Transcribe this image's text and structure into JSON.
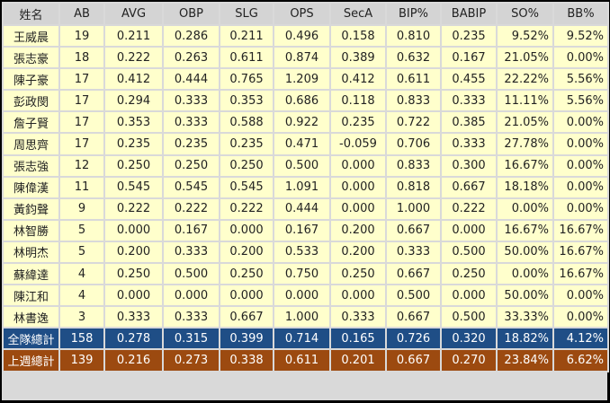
{
  "headers": [
    "姓名",
    "AB",
    "AVG",
    "OBP",
    "SLG",
    "OPS",
    "SecA",
    "BIP%",
    "BABIP",
    "SO%",
    "BB%"
  ],
  "rows": [
    [
      "王威晨",
      "19",
      "0.211",
      "0.286",
      "0.211",
      "0.496",
      "0.158",
      "0.810",
      "0.235",
      "9.52%",
      "9.52%"
    ],
    [
      "張志豪",
      "18",
      "0.222",
      "0.263",
      "0.611",
      "0.874",
      "0.389",
      "0.632",
      "0.167",
      "21.05%",
      "0.00%"
    ],
    [
      "陳子豪",
      "17",
      "0.412",
      "0.444",
      "0.765",
      "1.209",
      "0.412",
      "0.611",
      "0.455",
      "22.22%",
      "5.56%"
    ],
    [
      "彭政閔",
      "17",
      "0.294",
      "0.333",
      "0.353",
      "0.686",
      "0.118",
      "0.833",
      "0.333",
      "11.11%",
      "5.56%"
    ],
    [
      "詹子賢",
      "17",
      "0.353",
      "0.333",
      "0.588",
      "0.922",
      "0.235",
      "0.722",
      "0.385",
      "21.05%",
      "0.00%"
    ],
    [
      "周思齊",
      "17",
      "0.235",
      "0.235",
      "0.235",
      "0.471",
      "-0.059",
      "0.706",
      "0.333",
      "27.78%",
      "0.00%"
    ],
    [
      "張志強",
      "12",
      "0.250",
      "0.250",
      "0.250",
      "0.500",
      "0.000",
      "0.833",
      "0.300",
      "16.67%",
      "0.00%"
    ],
    [
      "陳偉漢",
      "11",
      "0.545",
      "0.545",
      "0.545",
      "1.091",
      "0.000",
      "0.818",
      "0.667",
      "18.18%",
      "0.00%"
    ],
    [
      "黃鈞聲",
      "9",
      "0.222",
      "0.222",
      "0.222",
      "0.444",
      "0.000",
      "1.000",
      "0.222",
      "0.00%",
      "0.00%"
    ],
    [
      "林智勝",
      "5",
      "0.000",
      "0.167",
      "0.000",
      "0.167",
      "0.200",
      "0.667",
      "0.000",
      "16.67%",
      "16.67%"
    ],
    [
      "林明杰",
      "5",
      "0.200",
      "0.333",
      "0.200",
      "0.533",
      "0.200",
      "0.333",
      "0.500",
      "50.00%",
      "16.67%"
    ],
    [
      "蘇緯達",
      "4",
      "0.250",
      "0.500",
      "0.250",
      "0.750",
      "0.250",
      "0.667",
      "0.250",
      "0.00%",
      "16.67%"
    ],
    [
      "陳江和",
      "4",
      "0.000",
      "0.000",
      "0.000",
      "0.000",
      "0.000",
      "0.500",
      "0.000",
      "50.00%",
      "0.00%"
    ],
    [
      "林書逸",
      "3",
      "0.333",
      "0.333",
      "0.667",
      "1.000",
      "0.333",
      "0.667",
      "0.500",
      "33.33%",
      "0.00%"
    ]
  ],
  "team_total": [
    "全隊總計",
    "158",
    "0.278",
    "0.315",
    "0.399",
    "0.714",
    "0.165",
    "0.726",
    "0.320",
    "18.82%",
    "4.12%"
  ],
  "last_week_total": [
    "上週總計",
    "139",
    "0.216",
    "0.273",
    "0.338",
    "0.611",
    "0.201",
    "0.667",
    "0.270",
    "23.84%",
    "6.62%"
  ],
  "colors": {
    "team_total": "#1f4e86",
    "last_week_total": "#9c4a10",
    "cell": "#ffffcc",
    "header": "#d4d4d4"
  }
}
